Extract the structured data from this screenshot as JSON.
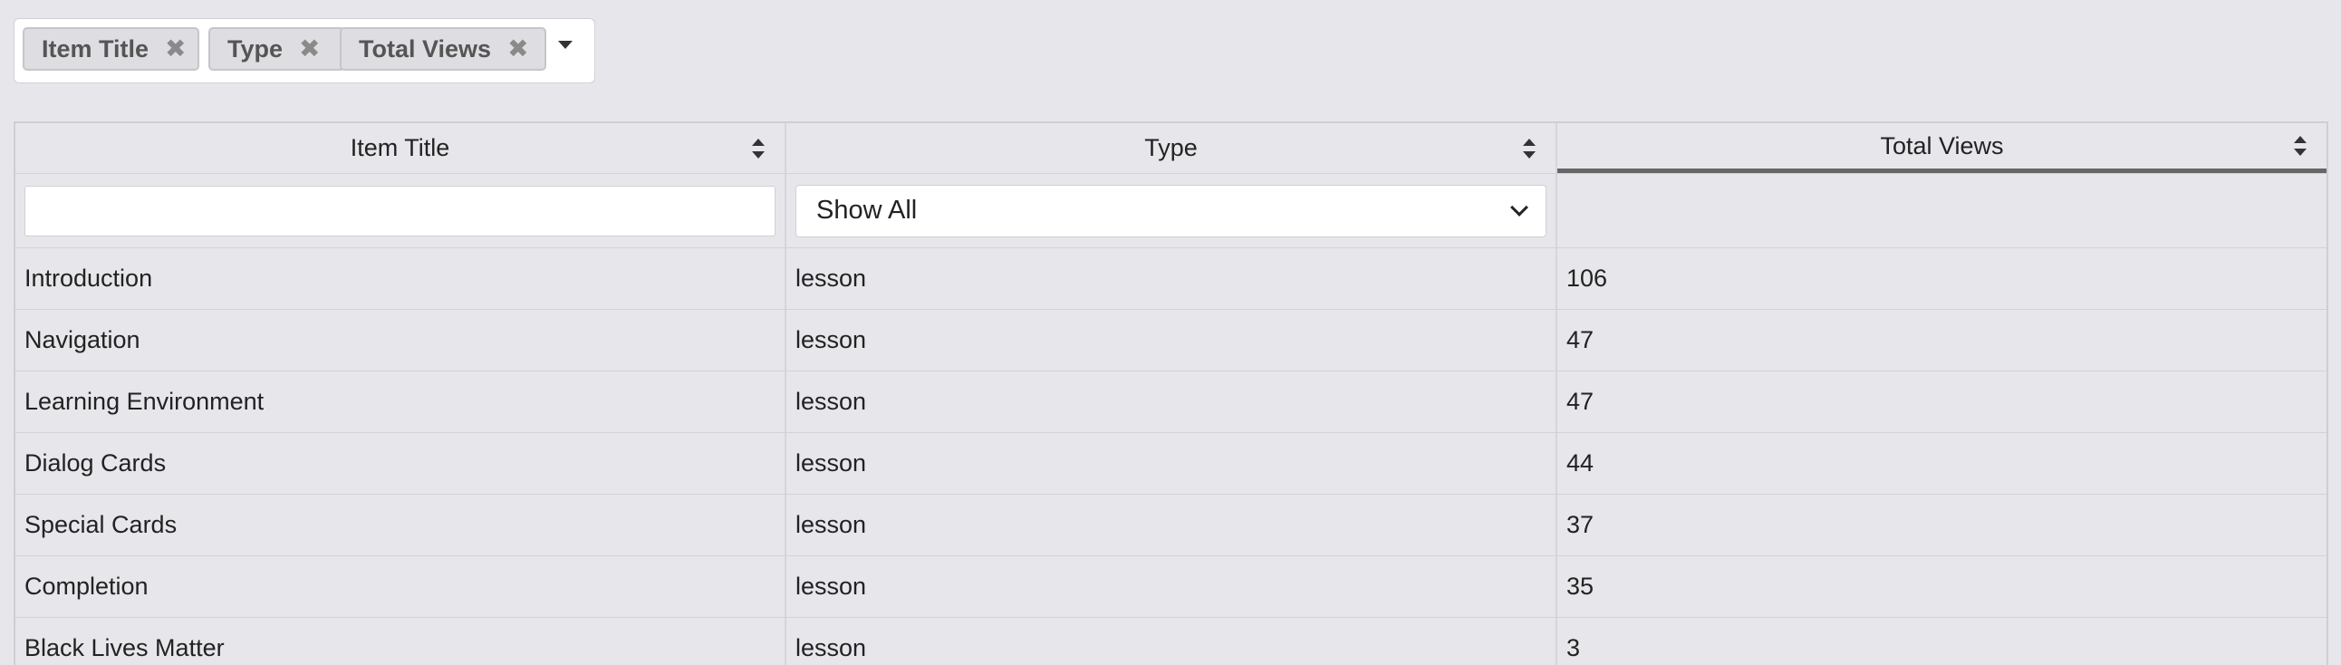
{
  "column_chooser": {
    "chips": [
      {
        "label": "Item Title",
        "remove_glyph": "✖"
      },
      {
        "label": "Type",
        "remove_glyph": "✖"
      },
      {
        "label": "Total Views",
        "remove_glyph": "✖"
      }
    ]
  },
  "table": {
    "headers": [
      "Item Title",
      "Type",
      "Total Views"
    ],
    "sorted_column": "Total Views",
    "filters": {
      "title_value": "",
      "type_selected": "Show All"
    },
    "rows": [
      [
        "Introduction",
        "lesson",
        "106"
      ],
      [
        "Navigation",
        "lesson",
        "47"
      ],
      [
        "Learning Environment",
        "lesson",
        "47"
      ],
      [
        "Dialog Cards",
        "lesson",
        "44"
      ],
      [
        "Special Cards",
        "lesson",
        "37"
      ],
      [
        "Completion",
        "lesson",
        "35"
      ],
      [
        "Black Lives Matter",
        "lesson",
        "3"
      ]
    ]
  },
  "colors": {
    "background": "#e7e6eb",
    "chip": "#dedde1",
    "sorted_indicator": "#666666"
  }
}
